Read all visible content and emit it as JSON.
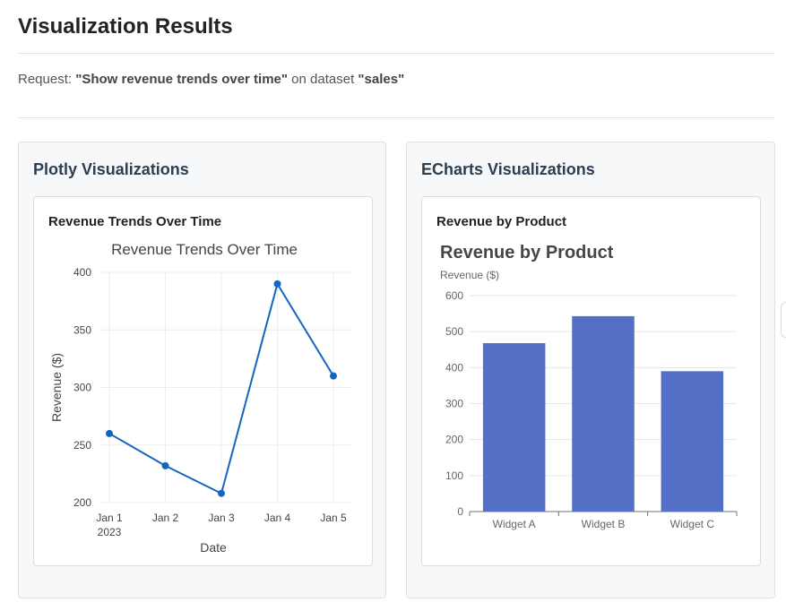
{
  "page": {
    "title": "Visualization Results",
    "request_prefix": "Request: ",
    "request_query": "\"Show revenue trends over time\"",
    "request_middle": " on dataset ",
    "request_dataset": "\"sales\""
  },
  "plotly_panel": {
    "title": "Plotly Visualizations",
    "card_title": "Revenue Trends Over Time"
  },
  "echarts_panel": {
    "title": "ECharts Visualizations",
    "card_title": "Revenue by Product"
  },
  "colors": {
    "line": "#1565c0",
    "bar": "#5470c6",
    "grid": "#ececec",
    "axis_text": "#444"
  },
  "chart_data": [
    {
      "type": "line",
      "title": "Revenue Trends Over Time",
      "xlabel": "Date",
      "ylabel": "Revenue ($)",
      "x": [
        "Jan 1",
        "Jan 2",
        "Jan 3",
        "Jan 4",
        "Jan 5"
      ],
      "x_sublabel": "2023",
      "series": [
        {
          "values": [
            260,
            232,
            208,
            390,
            310
          ]
        }
      ],
      "ylim": [
        200,
        400
      ],
      "yticks": [
        200,
        250,
        300,
        350,
        400
      ],
      "grid": true
    },
    {
      "type": "bar",
      "title": "Revenue by Product",
      "xlabel": "",
      "ylabel": "Revenue ($)",
      "categories": [
        "Widget A",
        "Widget B",
        "Widget C"
      ],
      "values": [
        468,
        543,
        390
      ],
      "ylim": [
        0,
        600
      ],
      "yticks": [
        0,
        100,
        200,
        300,
        400,
        500,
        600
      ],
      "grid": true
    }
  ]
}
